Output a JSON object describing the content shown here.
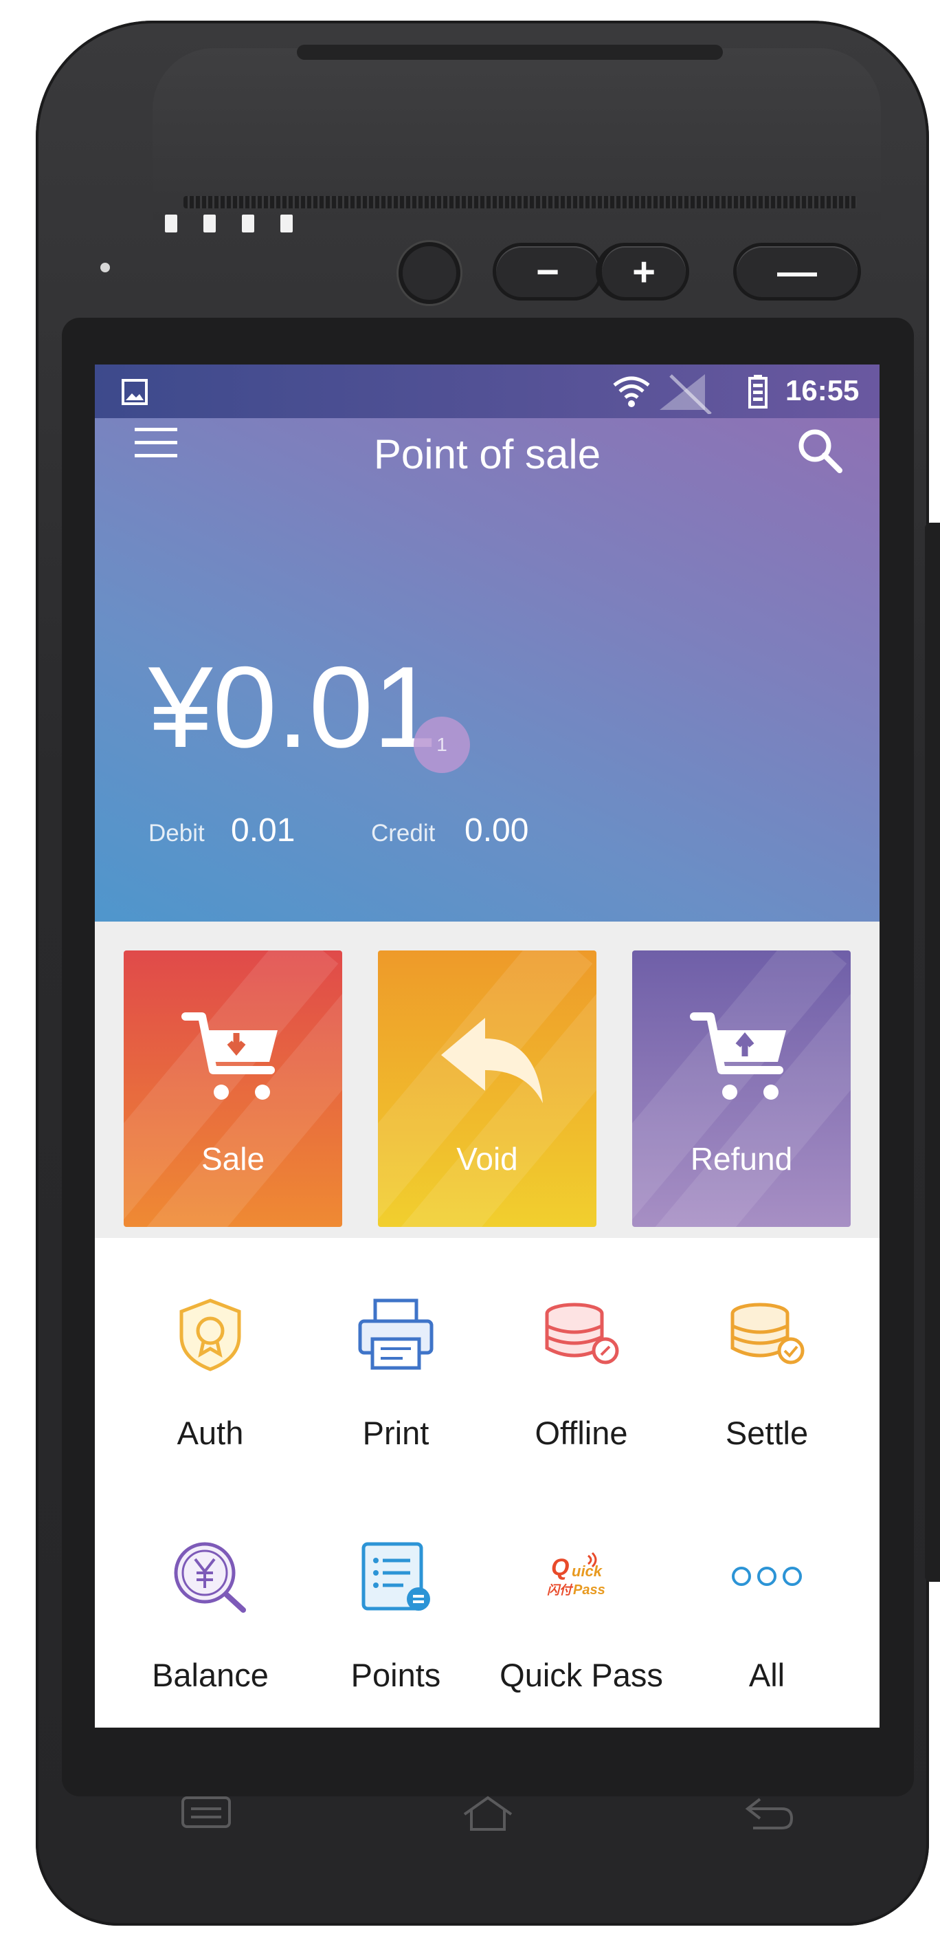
{
  "status_bar": {
    "time": "16:55"
  },
  "header": {
    "title": "Point of sale"
  },
  "summary": {
    "amount": "¥0.01",
    "badge_count": "1",
    "debit_label": "Debit",
    "debit_value": "0.01",
    "credit_label": "Credit",
    "credit_value": "0.00"
  },
  "actions": [
    {
      "label": "Sale",
      "color_top": "#e04a4a",
      "color_bottom": "#ef8a33"
    },
    {
      "label": "Void",
      "color_top": "#ee9a2a",
      "color_bottom": "#f1cf2e"
    },
    {
      "label": "Refund",
      "color_top": "#6f5fa8",
      "color_bottom": "#a78fc4"
    }
  ],
  "functions": [
    {
      "label": "Auth",
      "icon": "shield-badge-icon"
    },
    {
      "label": "Print",
      "icon": "printer-icon"
    },
    {
      "label": "Offline",
      "icon": "coins-offline-icon"
    },
    {
      "label": "Settle",
      "icon": "coins-settle-icon"
    },
    {
      "label": "Balance",
      "icon": "yuan-search-icon"
    },
    {
      "label": "Points",
      "icon": "points-list-icon"
    },
    {
      "label": "Quick Pass",
      "icon": "quickpass-logo-icon",
      "logo_text": "Quick Pass"
    },
    {
      "label": "All",
      "icon": "more-dots-icon"
    }
  ],
  "device": {
    "buttons": {
      "minus": "−",
      "plus": "+",
      "power": "—"
    }
  }
}
